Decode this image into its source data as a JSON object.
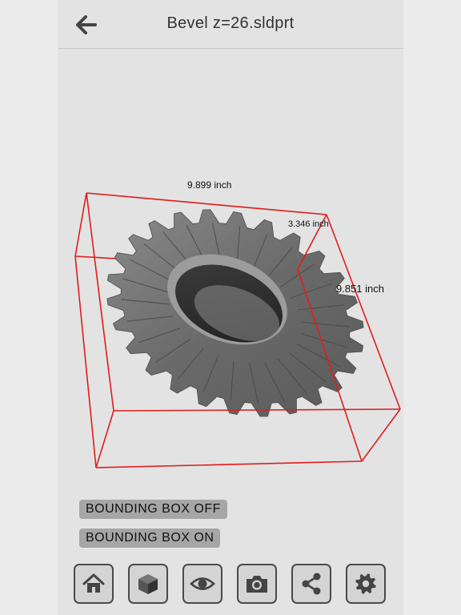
{
  "header": {
    "title": "Bevel z=26.sldprt"
  },
  "viewport": {
    "dimensions": {
      "width_label": "9.899 inch",
      "depth_label": "3.346 inch",
      "height_label": "9.851 inch"
    },
    "box_color": "#e11d1d",
    "model_color": "#6d6d6d"
  },
  "controls": {
    "bbox_off_label": "BOUNDING BOX OFF",
    "bbox_on_label": "BOUNDING BOX ON"
  },
  "toolbar": {
    "items": [
      {
        "icon": "home-icon"
      },
      {
        "icon": "cube-icon"
      },
      {
        "icon": "eye-icon"
      },
      {
        "icon": "camera-icon"
      },
      {
        "icon": "share-icon"
      },
      {
        "icon": "gear-icon"
      }
    ]
  }
}
